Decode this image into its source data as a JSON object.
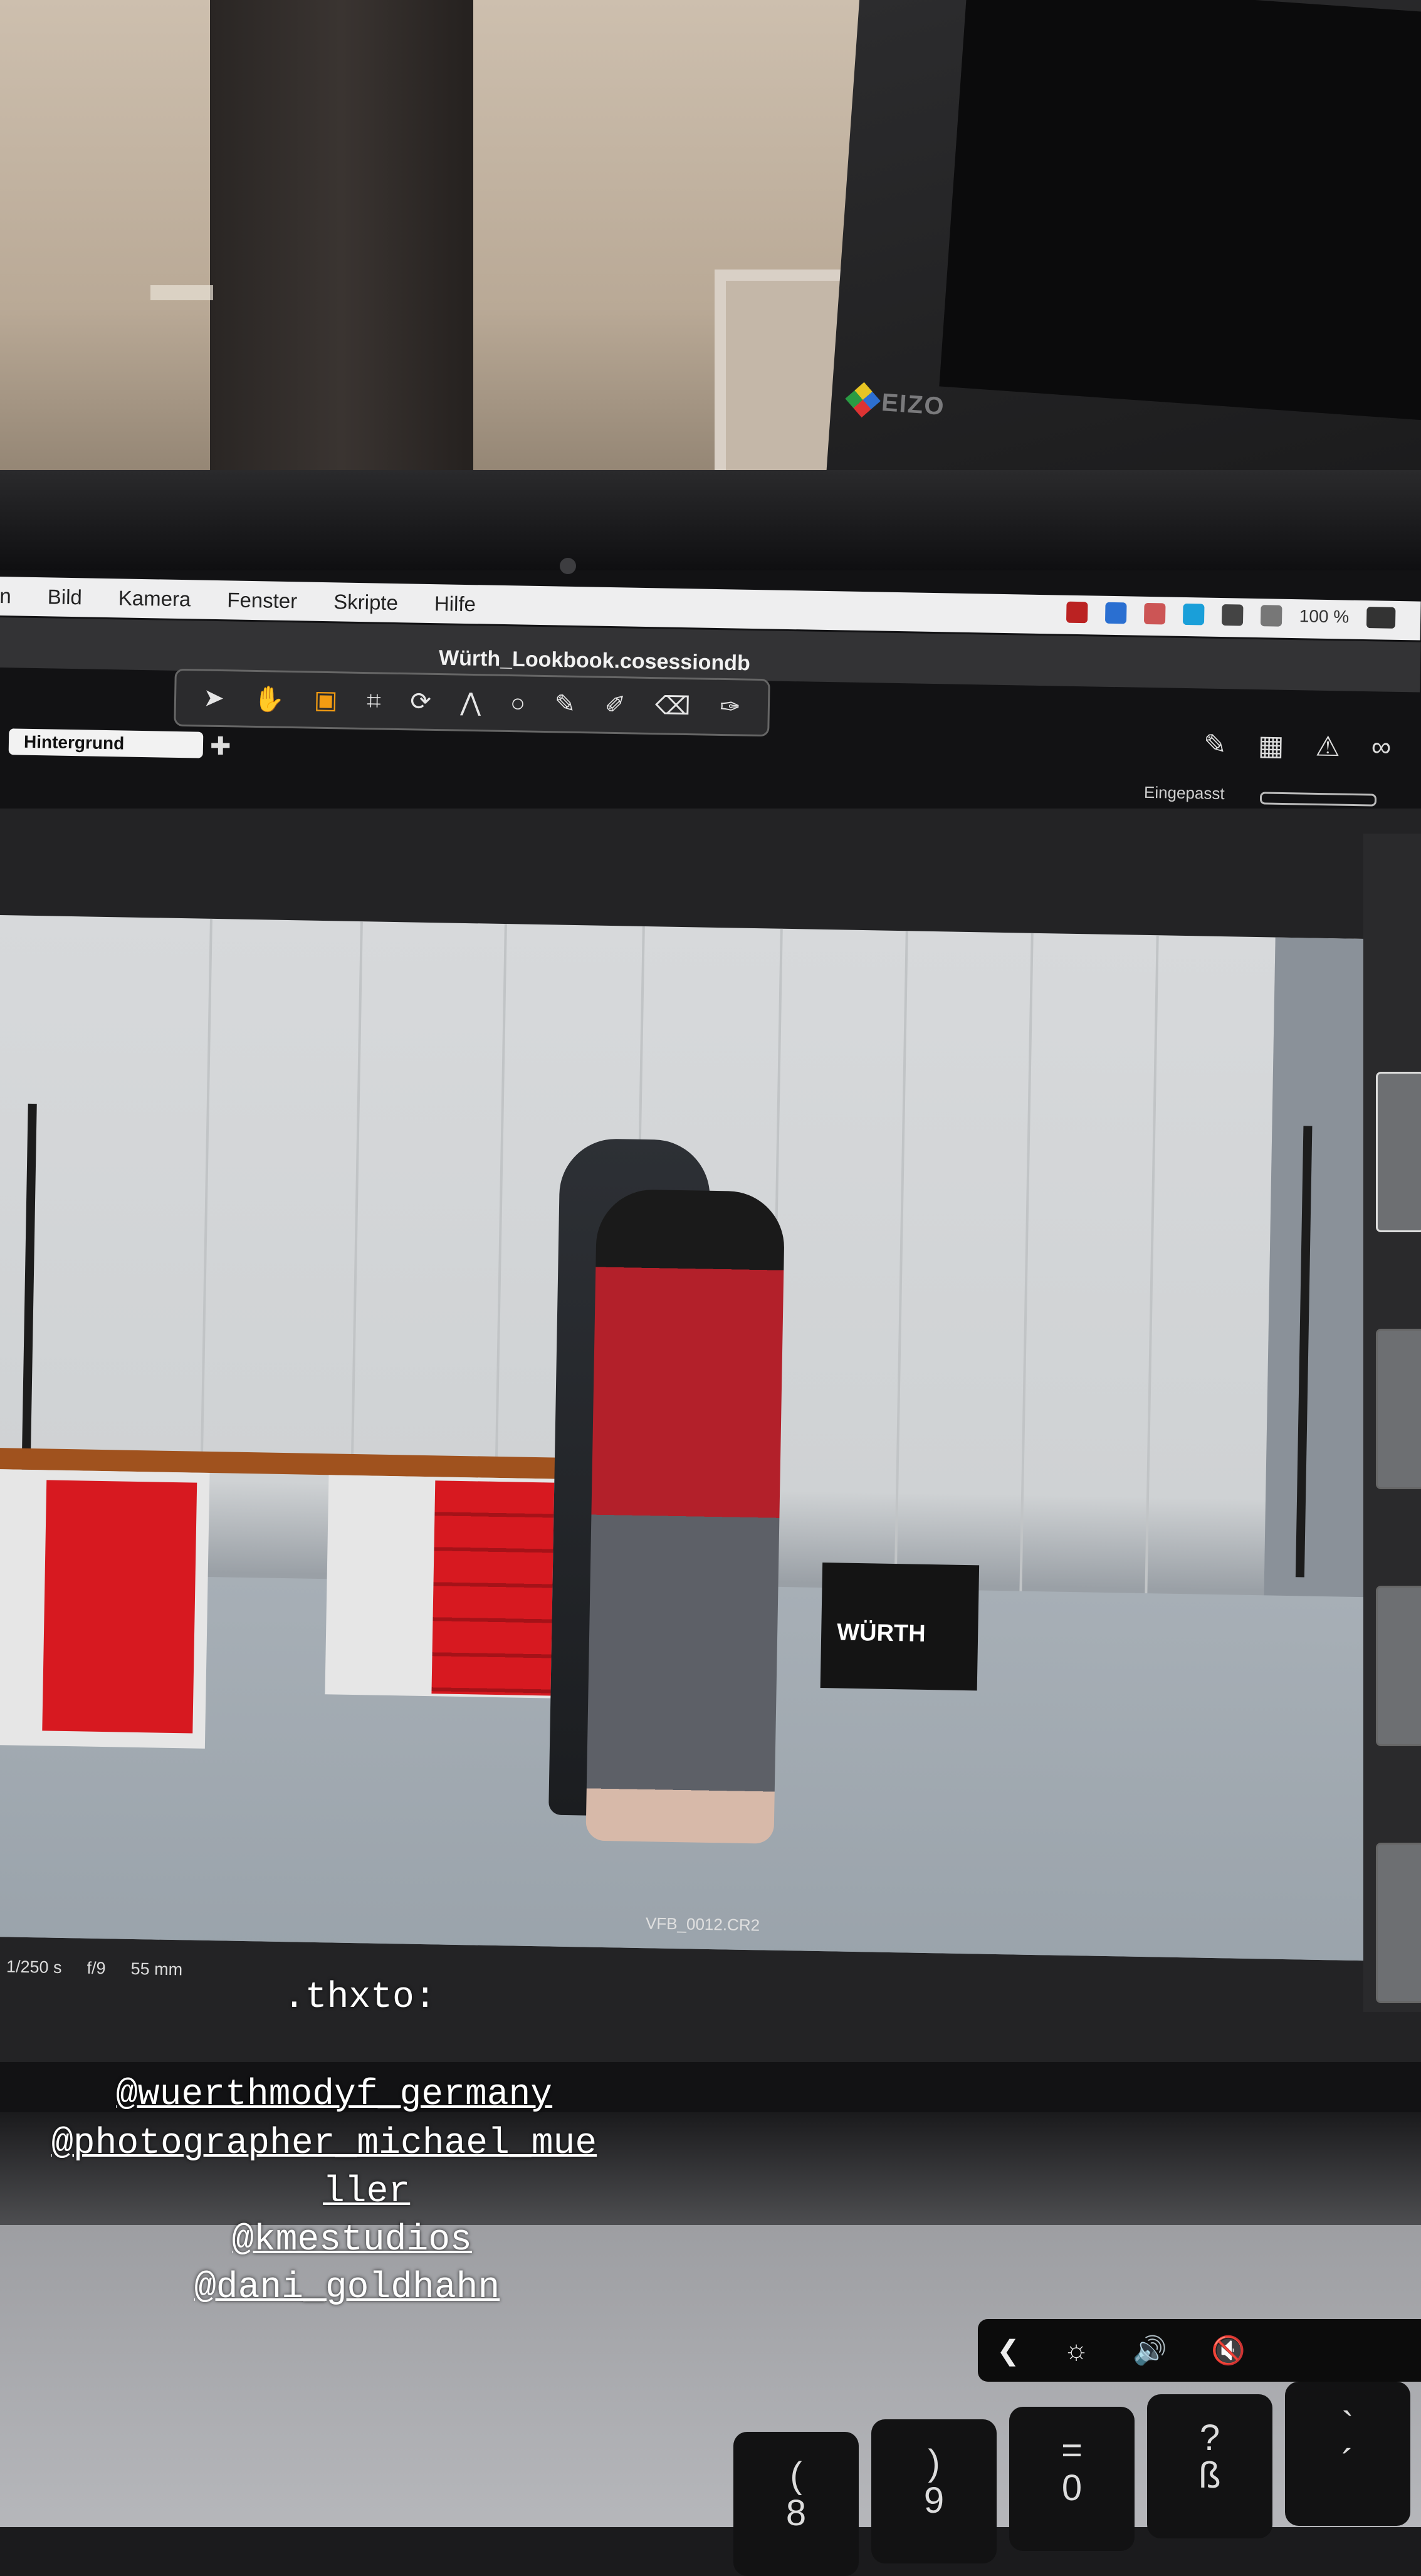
{
  "menubar": {
    "items": [
      "n",
      "Bild",
      "Kamera",
      "Fenster",
      "Skripte",
      "Hilfe"
    ],
    "battery": "100 %"
  },
  "app": {
    "window_title": "Würth_Lookbook.cosessiondb",
    "layer_select": "Hintergrund",
    "fit_label": "Eingepasst",
    "filename": "VFB_0012.CR2",
    "exif": {
      "shutter": "1/250 s",
      "aperture": "f/9",
      "focal": "55 mm"
    }
  },
  "photo": {
    "case_brand": "WÜRTH"
  },
  "monitor": {
    "brand": "EIZO"
  },
  "keyboard": {
    "touchbar": [
      "❮",
      "☼",
      "🔊",
      "🔇"
    ],
    "keys": [
      {
        "top": "?",
        "bottom": "ß"
      },
      {
        "top": "=",
        "bottom": "0"
      },
      {
        "top": ")",
        "bottom": "9"
      },
      {
        "top": "(",
        "bottom": "8"
      },
      {
        "top": "`",
        "bottom": "´"
      }
    ]
  },
  "story": {
    "heading": ".thxto:",
    "mentions": [
      "@wuerthmodyf_germany",
      "@photographer_michael_mue",
      "ller",
      "@kmestudios",
      "@dani_goldhahn"
    ]
  }
}
